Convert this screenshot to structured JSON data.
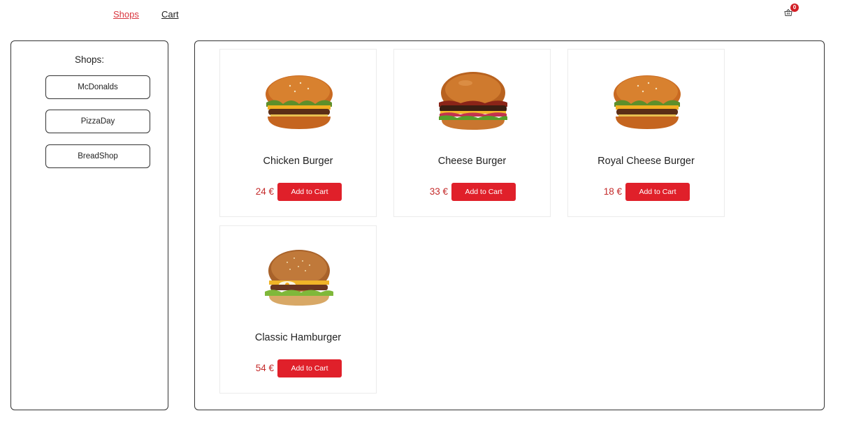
{
  "nav": {
    "shops_label": "Shops",
    "cart_label": "Cart",
    "cart_count": "0",
    "accent_color": "#d9363e"
  },
  "sidebar": {
    "title": "Shops:",
    "shops": [
      "McDonalds",
      "PizzaDay",
      "BreadShop"
    ]
  },
  "products": [
    {
      "name": "Chicken Burger",
      "price": "24 €",
      "button": "Add to Cart",
      "image": "burger-chicken"
    },
    {
      "name": "Cheese Burger",
      "price": "33 €",
      "button": "Add to Cart",
      "image": "burger-cheese"
    },
    {
      "name": "Royal Cheese Burger",
      "price": "18 €",
      "button": "Add to Cart",
      "image": "burger-chicken"
    },
    {
      "name": "Classic Hamburger",
      "price": "54 €",
      "button": "Add to Cart",
      "image": "burger-classic"
    }
  ],
  "colors": {
    "button": "#e0202a",
    "price": "#c42a2a",
    "badge": "#d21f26"
  }
}
